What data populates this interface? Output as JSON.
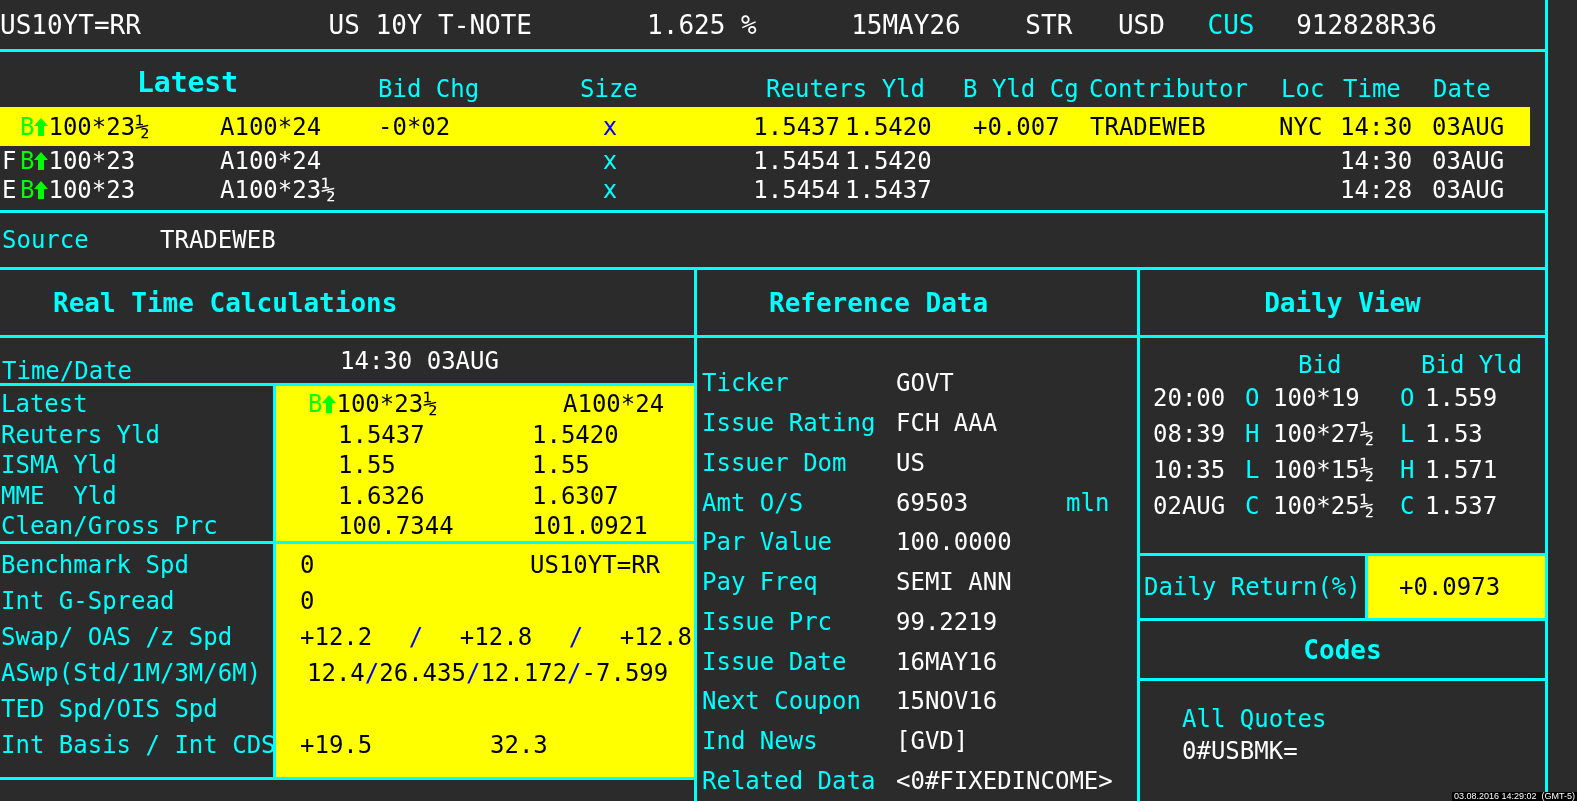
{
  "top_bar": {
    "items": [
      {
        "text": "US10YT=RR",
        "kind": "plain"
      },
      {
        "text": "US 10Y T-NOTE",
        "kind": "plain"
      },
      {
        "text": "1.625 %",
        "kind": "plain"
      },
      {
        "text": "15MAY26",
        "kind": "plain"
      },
      {
        "text": "STR",
        "kind": "plain"
      },
      {
        "text": "USD",
        "kind": "plain"
      },
      {
        "text": "CUS",
        "kind": "accent"
      },
      {
        "text": "912828R36",
        "kind": "plain"
      }
    ]
  },
  "quote_table": {
    "columns": [
      "Latest",
      "Bid Chg",
      "Size",
      "Reuters Yld",
      "B Yld Cg",
      "Contributor",
      "Loc",
      "Time",
      "Date"
    ],
    "rows": [
      {
        "selected": true,
        "prefix": "",
        "side": "B",
        "up": true,
        "bid": "100*23½",
        "ask": "A100*24",
        "bid_chg": "-0*02",
        "size": "x",
        "yld_bid": "1.5437",
        "yld_ask": "1.5420",
        "b_yld_cg": "+0.007",
        "contributor": "TRADEWEB",
        "loc": "NYC",
        "time": "14:30",
        "date": "03AUG"
      },
      {
        "selected": false,
        "prefix": "F",
        "side": "B",
        "up": true,
        "bid": "100*23",
        "ask": "A100*24",
        "size": "x",
        "yld_bid": "1.5454",
        "yld_ask": "1.5420",
        "time": "14:30",
        "date": "03AUG"
      },
      {
        "selected": false,
        "prefix": "E",
        "side": "B",
        "up": true,
        "bid": "100*23",
        "ask": "A100*23½",
        "size": "x",
        "yld_bid": "1.5454",
        "yld_ask": "1.5437",
        "time": "14:28",
        "date": "03AUG"
      }
    ]
  },
  "source": {
    "label": "Source",
    "value": "TRADEWEB"
  },
  "real_time_calculations": {
    "title": "Real Time Calculations",
    "time_date": {
      "label": "Time/Date",
      "value": "14:30 03AUG"
    },
    "groups": [
      {
        "rows": [
          {
            "kind": "quote",
            "label": "Latest",
            "side": "B",
            "up": true,
            "bid": "100*23½",
            "ask": "A100*24"
          },
          {
            "kind": "pair",
            "label": "Reuters Yld",
            "values": [
              "1.5437",
              "1.5420"
            ]
          },
          {
            "kind": "pair",
            "label": "ISMA Yld",
            "values": [
              "1.55",
              "1.55"
            ]
          },
          {
            "kind": "pair",
            "label": "MME  Yld",
            "values": [
              "1.6326",
              "1.6307"
            ]
          },
          {
            "kind": "pair",
            "label": "Clean/Gross Prc",
            "values": [
              "100.7344",
              "101.0921"
            ]
          }
        ]
      },
      {
        "rows": [
          {
            "kind": "wide_pair",
            "label": "Benchmark Spd",
            "values": [
              "0",
              "US10YT=RR"
            ]
          },
          {
            "kind": "wide_pair",
            "label": "Int G-Spread",
            "values": [
              "0"
            ]
          },
          {
            "kind": "spaced",
            "label": "Swap/ OAS /z Spd",
            "separator": "/",
            "values": [
              "+12.2",
              "+12.8",
              "+12.8"
            ]
          },
          {
            "kind": "compact",
            "label": "ASwp(Std/1M/3M/6M)",
            "separator": "/",
            "values": [
              "12.4",
              "26.435",
              "12.172",
              "-7.599"
            ]
          },
          {
            "kind": "wide_pair",
            "label": "TED Spd/OIS Spd",
            "values": []
          },
          {
            "kind": "wide_pair",
            "label": "Int Basis / Int CDS",
            "values": [
              "+19.5",
              "32.3"
            ]
          }
        ]
      }
    ]
  },
  "reference_data": {
    "title": "Reference Data",
    "rows": [
      {
        "label": "Ticker",
        "value": "GOVT"
      },
      {
        "label": "Issue Rating",
        "value": "FCH AAA"
      },
      {
        "label": "Issuer Dom",
        "value": "US"
      },
      {
        "label": "Amt O/S",
        "value": "69503",
        "unit": "mln"
      },
      {
        "label": "Par Value",
        "value": "100.0000"
      },
      {
        "label": "Pay Freq",
        "value": "SEMI ANN"
      },
      {
        "label": "Issue Prc",
        "value": "99.2219"
      },
      {
        "label": "Issue Date",
        "value": "16MAY16"
      },
      {
        "label": "Next Coupon",
        "value": "15NOV16"
      },
      {
        "label": "Ind News",
        "value": "[GVD]"
      },
      {
        "label": "Related Data",
        "value": "<0#FIXEDINCOME>"
      }
    ]
  },
  "daily_view": {
    "title": "Daily View",
    "columns": [
      "Bid",
      "Bid Yld"
    ],
    "rows": [
      {
        "time": "20:00",
        "bid_flag": "O",
        "bid": "100*19",
        "yld_flag": "O",
        "yld": "1.559"
      },
      {
        "time": "08:39",
        "bid_flag": "H",
        "bid": "100*27½",
        "yld_flag": "L",
        "yld": "1.53"
      },
      {
        "time": "10:35",
        "bid_flag": "L",
        "bid": "100*15½",
        "yld_flag": "H",
        "yld": "1.571"
      },
      {
        "time": "02AUG",
        "bid_flag": "C",
        "bid": "100*25½",
        "yld_flag": "C",
        "yld": "1.537"
      }
    ],
    "daily_return": {
      "label": "Daily Return(%)",
      "value": "+0.0973"
    }
  },
  "codes": {
    "title": "Codes",
    "label": "All Quotes",
    "value": "0#USBMK="
  },
  "status": {
    "timestamp": "03.08.2016 14:29:02  (GMT-5)"
  }
}
